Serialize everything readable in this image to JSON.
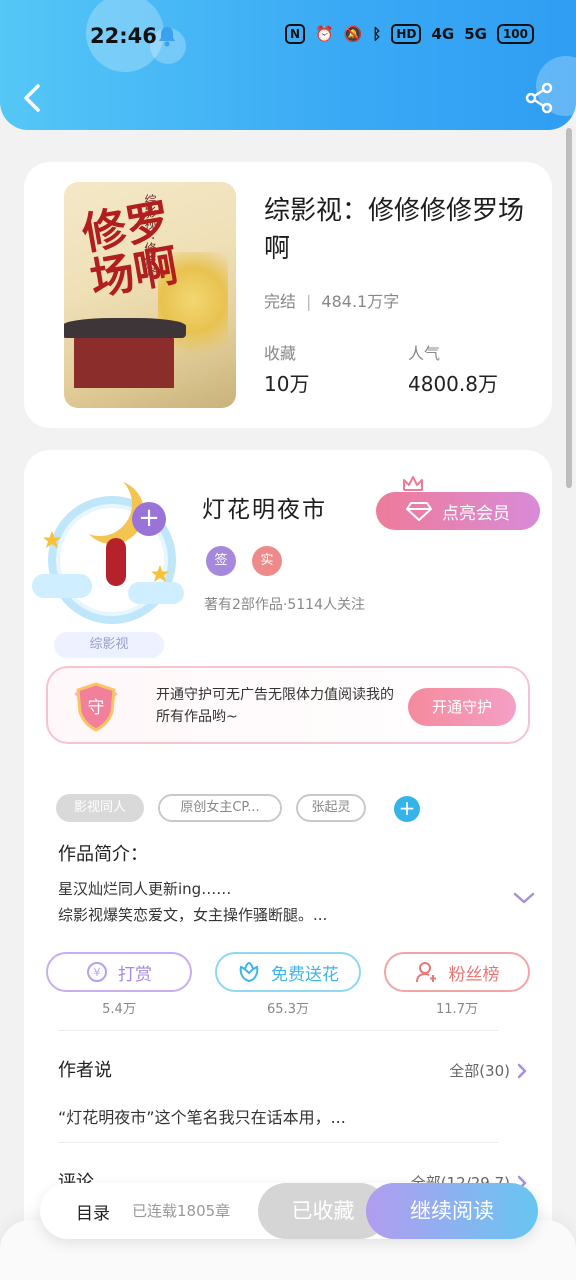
{
  "status_bar": {
    "time": "22:46",
    "nfc": "N",
    "hd": "HD",
    "network1": "4G",
    "network2": "5G",
    "battery": "100"
  },
  "book": {
    "cover_title": "修罗场啊",
    "cover_subtitle": "综影视：修修修",
    "title": "综影视：修修修修罗场啊",
    "status": "完结",
    "word_count": "484.1万字",
    "favorites_label": "收藏",
    "favorites_value": "10万",
    "popularity_label": "人气",
    "popularity_value": "4800.8万"
  },
  "author": {
    "name": "灯花明夜市",
    "badge_sign": "签",
    "badge_real": "实",
    "info": "著有2部作品·5114人关注",
    "avatar_tag": "综影视",
    "vip_button": "点亮会员"
  },
  "guard": {
    "shield_char": "守",
    "text": "开通守护可无广告无限体力值阅读我的所有作品哟~",
    "button": "开通守护"
  },
  "tags": [
    "影视同人",
    "原创女主CP...",
    "张起灵"
  ],
  "intro": {
    "heading": "作品简介：",
    "line1": "星汉灿烂同人更新ing……",
    "line2": "综影视爆笑恋爱文，女主操作骚断腿。..."
  },
  "actions": [
    {
      "label": "打赏",
      "count": "5.4万",
      "color": "#b48ce6"
    },
    {
      "label": "免费送花",
      "count": "65.3万",
      "color": "#45c1ec"
    },
    {
      "label": "粉丝榜",
      "count": "11.7万",
      "color": "#f08080"
    }
  ],
  "author_says": {
    "heading": "作者说",
    "more": "全部(30)",
    "text": "“灯花明夜市”这个笔名我只在话本用，..."
  },
  "comments": {
    "heading": "评论",
    "more": "全部(12/29.7)"
  },
  "bottom_bar": {
    "toc": "目录",
    "serial_info": "已连载1805章",
    "collected": "已收藏",
    "continue": "继续阅读"
  }
}
